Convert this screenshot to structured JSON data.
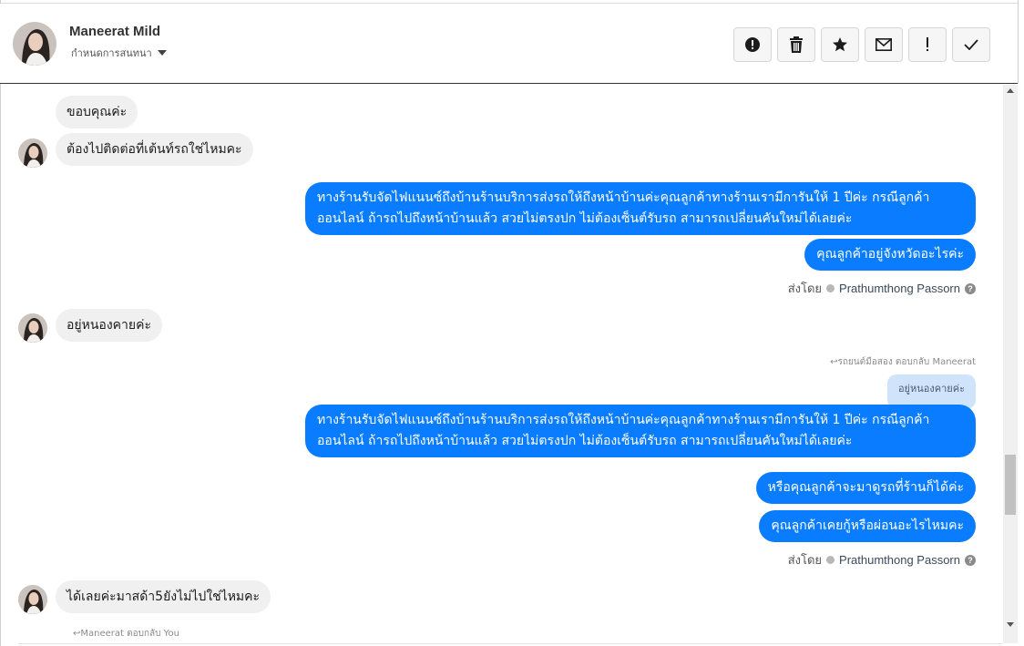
{
  "header": {
    "contact_name": "Maneerat Mild",
    "assign_label": "กำหนดการสนทนา",
    "actions": [
      "mark-spam",
      "delete",
      "star",
      "mark-unread",
      "important",
      "done"
    ]
  },
  "messages": {
    "m1": "ขอบคุณค่ะ",
    "m2": "ต้องไปติดต่อที่เต้นท์รถใช่ไหมคะ",
    "m3": "ทางร้านรับจัดไฟแนนซ์ถึงบ้านร้านบริการส่งรถให้ถึงหน้าบ้านค่ะคุณลูกค้าทางร้านเรามีการันให้ 1 ปีค่ะ กรณีลูกค้าออนไลน์ ถ้ารถไปถึงหน้าบ้านแล้ว สวยไม่ตรงปก ไม่ต้องเซ็นต์รับรถ สามารถเปลี่ยนคันใหม่ได้เลยค่ะ",
    "m4": "คุณลูกค้าอยู่จังหวัดอะไรค่ะ",
    "sent_by_1": "ส่งโดย",
    "agent_1": "Prathumthong Passorn",
    "m5": "อยู่หนองคายค่ะ",
    "reply_note_1": "รถยนต์มือสอง ตอบกลับ Maneerat",
    "quoted_1": "อยู่หนองคายค่ะ",
    "m6": "ทางร้านรับจัดไฟแนนซ์ถึงบ้านร้านบริการส่งรถให้ถึงหน้าบ้านค่ะคุณลูกค้าทางร้านเรามีการันให้ 1 ปีค่ะ กรณีลูกค้าออนไลน์ ถ้ารถไปถึงหน้าบ้านแล้ว สวยไม่ตรงปก ไม่ต้องเซ็นต์รับรถ สามารถเปลี่ยนคันใหม่ได้เลยค่ะ",
    "m7": "หรือคุณลูกค้าจะมาดูรถที่ร้านก็ได้ค่ะ",
    "m8": "คุณลูกค้าเคยกู้หรือผ่อนอะไรไหมคะ",
    "sent_by_2": "ส่งโดย",
    "agent_2": "Prathumthong Passorn",
    "m9": "ได้เลยค่ะมาสด้า5ยังไม่ไปใช่ไหมคะ",
    "reply_note_2": "Maneerat ตอบกลับ You"
  },
  "colors": {
    "outgoing_bubble": "#0a7cff",
    "incoming_bubble": "#f0f0f0",
    "quoted_bubble": "#cfe3fb"
  }
}
